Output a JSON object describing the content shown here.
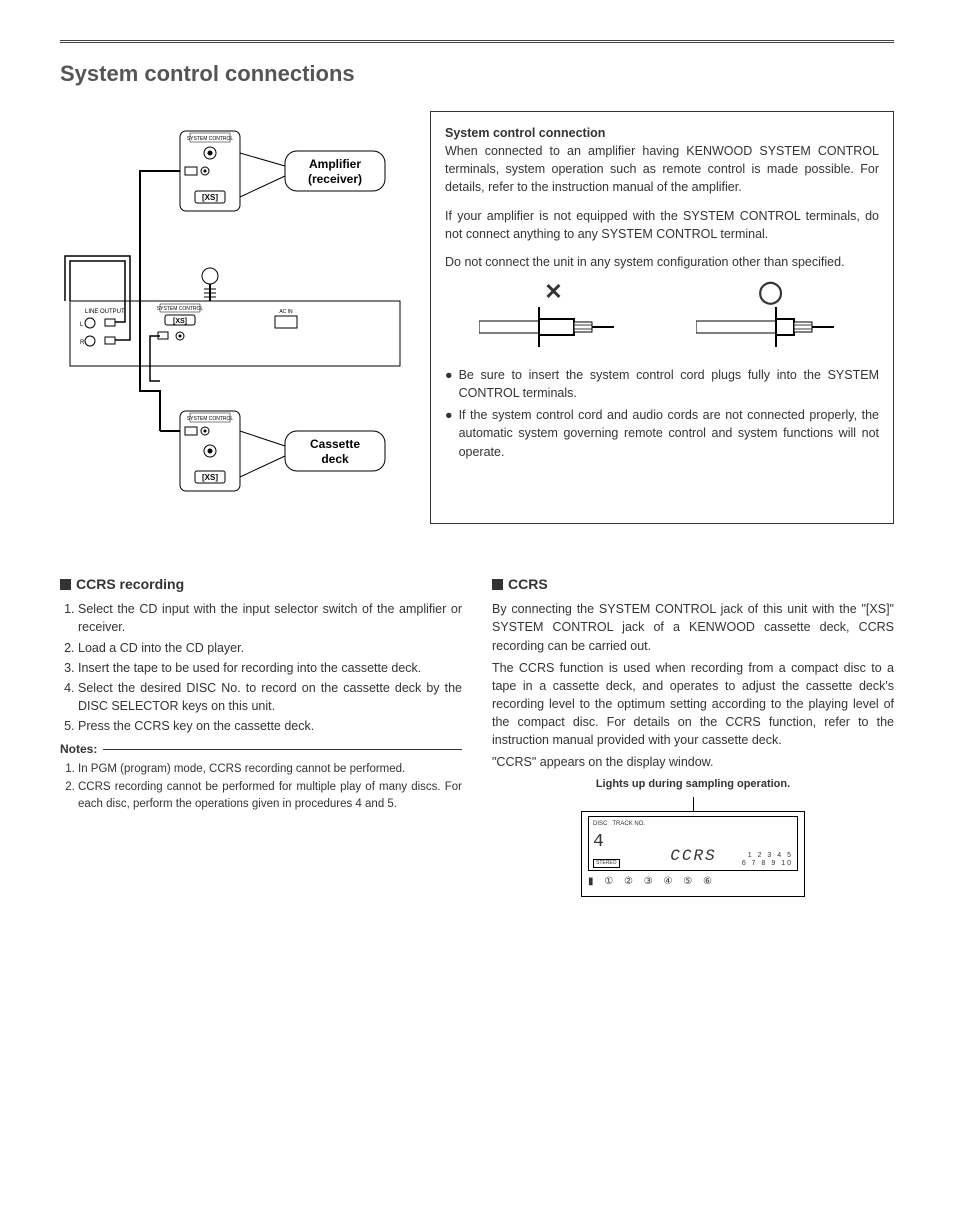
{
  "page_title": "System control connections",
  "diagram": {
    "amp_label1": "Amplifier",
    "amp_label2": "(receiver)",
    "cassette_label1": "Cassette",
    "cassette_label2": "deck",
    "sys_ctrl": "SYSTEM CONTROL",
    "xs": "[XS]",
    "line_output": "LINE OUTPUT",
    "ac": "AC IN"
  },
  "info": {
    "heading": "System control connection",
    "p1": "When connected to an amplifier having KENWOOD SYSTEM CONTROL terminals, system operation such as remote control is made possible. For details, refer to the instruction manual of the amplifier.",
    "p2": "If your amplifier is not equipped with the SYSTEM CONTROL terminals, do not connect anything to any SYSTEM CONTROL terminal.",
    "p3": "Do not connect the unit in any system configuration other than specified.",
    "x_mark": "✕",
    "o_mark": "◯",
    "b1": "Be sure to insert the system control cord plugs fully into the SYSTEM CONTROL terminals.",
    "b2": "If the system control cord and audio cords are not connected properly, the automatic system governing remote control and system functions will not operate."
  },
  "ccrs_rec": {
    "heading": "CCRS recording",
    "steps": [
      "Select the CD input with the input selector switch of the amplifier or receiver.",
      "Load a CD into the CD player.",
      "Insert the tape to be used for recording into the cassette deck.",
      "Select the desired DISC No. to record on the cassette deck by the DISC SELECTOR keys on this unit.",
      "Press the CCRS key on the cassette deck."
    ],
    "notes_label": "Notes:",
    "notes": [
      "In PGM (program) mode, CCRS recording cannot be performed.",
      "CCRS recording cannot be performed for multiple play of many discs. For each disc, perform the operations given in procedures 4 and 5."
    ]
  },
  "ccrs": {
    "heading": "CCRS",
    "p1": "By connecting the SYSTEM CONTROL jack of this unit with the \"[XS]\" SYSTEM CONTROL jack of a KENWOOD cassette deck, CCRS recording can be carried out.",
    "p2": "The CCRS function is used when recording from a compact disc to a tape in a cassette deck, and operates to adjust the cassette deck's recording level to the optimum setting according to the playing level of the compact disc. For details on the CCRS function, refer to the instruction manual provided with your cassette deck.",
    "p3": "\"CCRS\" appears on the display window.",
    "caption": "Lights up during sampling operation.",
    "display": {
      "disc_label": "DISC",
      "track_label": "TRACK NO.",
      "disc_no": "4",
      "ccrs_text": "CCRS",
      "tracks_row1": "1 2 3 4 5",
      "tracks_row2": "6 7 8 9 10",
      "stereo": "STEREO",
      "disc_icons": "▮ ① ② ③ ④ ⑤ ⑥"
    }
  }
}
